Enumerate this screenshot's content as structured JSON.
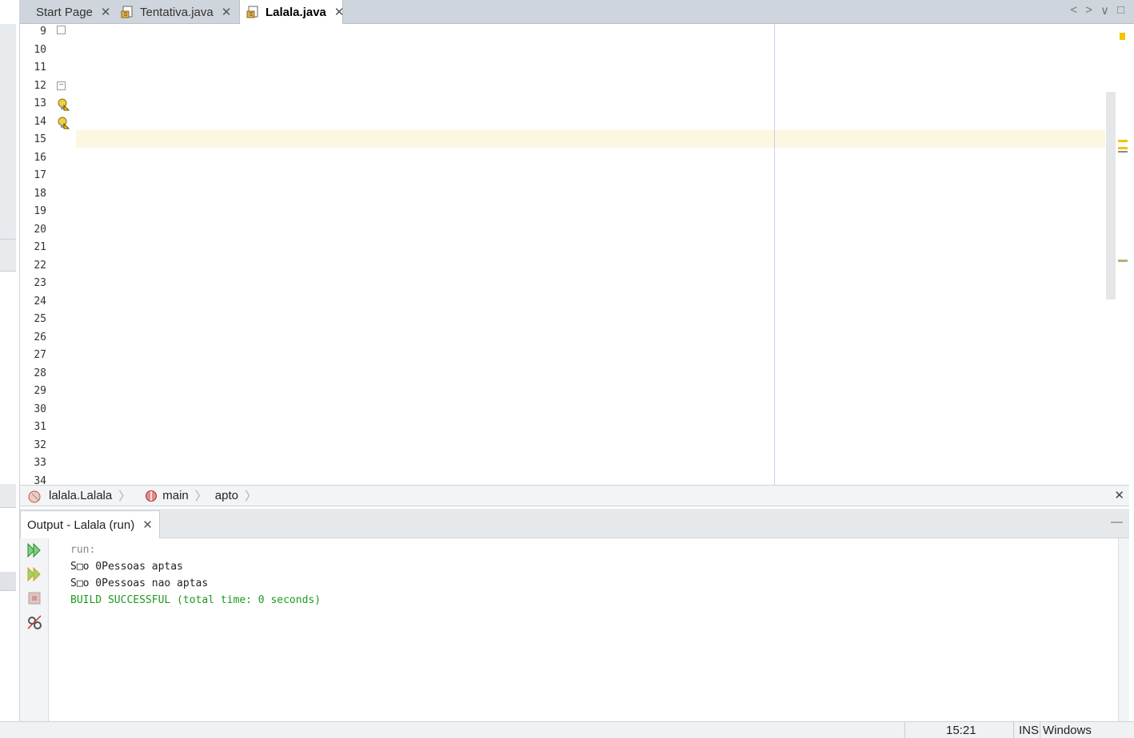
{
  "tabs": [
    {
      "label": "Start Page",
      "active": false,
      "icon": "none"
    },
    {
      "label": "Tentativa.java",
      "active": false,
      "icon": "java-file-icon"
    },
    {
      "label": "Lalala.java",
      "active": true,
      "icon": "java-file-icon"
    }
  ],
  "tab_controls": {
    "prev": "<",
    "next": ">",
    "dropdown": "∨",
    "maximize": "□"
  },
  "editor": {
    "line_numbers": [
      "9",
      "10",
      "11",
      "12",
      "13",
      "14",
      "15",
      "16",
      "17",
      "18",
      "19",
      "20",
      "21",
      "22",
      "23",
      "24",
      "25",
      "26",
      "27",
      "28",
      "29",
      "30",
      "31",
      "32",
      "33",
      "34"
    ],
    "current_line": 15,
    "fold_markers": {
      "10": "−",
      "12": "−"
    }
  },
  "breadcrumb": {
    "class": "lalala.Lalala",
    "method": "main",
    "field": "apto"
  },
  "output": {
    "tab_label": "Output - Lalala (run)",
    "lines": [
      {
        "text": "run:",
        "color": "#888888"
      },
      {
        "text": "S□o 0Pessoas aptas",
        "color": "#222222"
      },
      {
        "text": "S□o 0Pessoas nao aptas",
        "color": "#222222"
      },
      {
        "text": "BUILD SUCCESSFUL (total time: 0 seconds)",
        "color": "#1e9a1e"
      }
    ],
    "minimize": "—"
  },
  "status": {
    "position": "15:21",
    "mode": "INS",
    "line_endings": "Windows (CRLF)"
  },
  "colors": {
    "keyword": "#2c58c7",
    "string": "#2e8b57",
    "static_field": "#8d58c6",
    "current_line_bg": "#fcf7e1"
  }
}
